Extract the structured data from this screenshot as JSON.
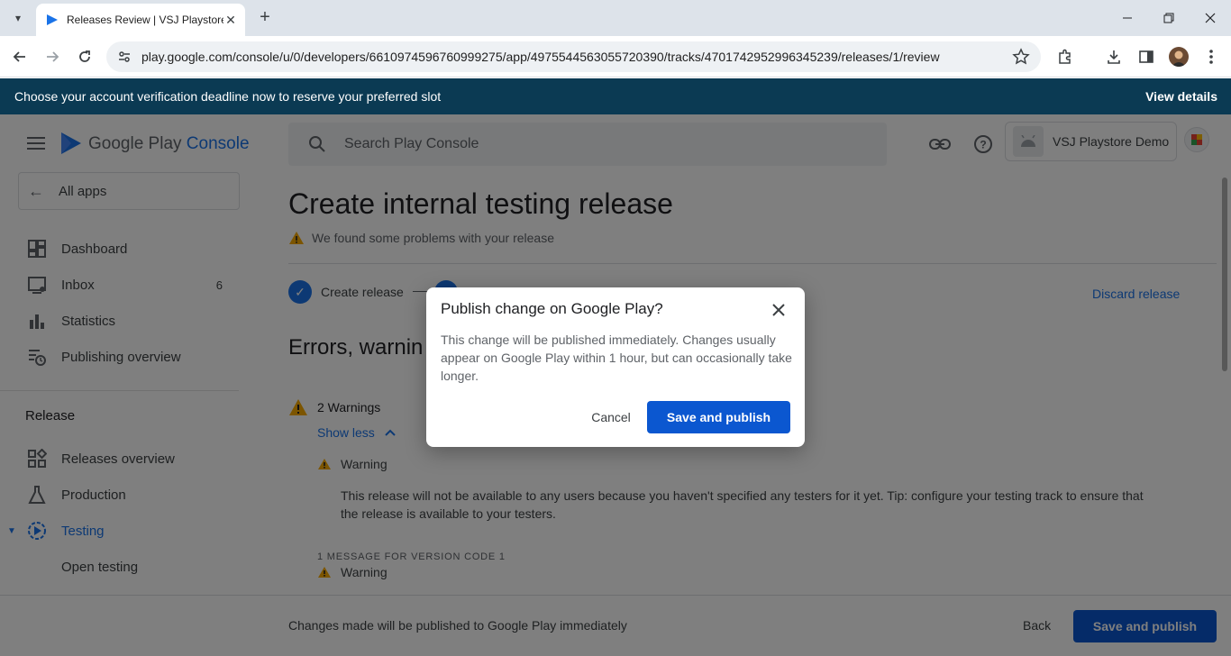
{
  "browser": {
    "tab_title": "Releases Review | VSJ Playstore",
    "url": "play.google.com/console/u/0/developers/6610974596760999275/app/4975544563055720390/tracks/4701742952996345239/releases/1/review"
  },
  "banner": {
    "message": "Choose your account verification deadline now to reserve your preferred slot",
    "link": "View details"
  },
  "header": {
    "logo_google_play": "Google Play",
    "logo_console": "Console",
    "search_placeholder": "Search Play Console",
    "account_name": "VSJ Playstore Demo"
  },
  "sidebar": {
    "all_apps": "All apps",
    "items": [
      {
        "label": "Dashboard"
      },
      {
        "label": "Inbox",
        "count": "6"
      },
      {
        "label": "Statistics"
      },
      {
        "label": "Publishing overview"
      }
    ],
    "release_section": "Release",
    "release_items": [
      {
        "label": "Releases overview"
      },
      {
        "label": "Production"
      },
      {
        "label": "Testing"
      },
      {
        "label": "Open testing"
      }
    ]
  },
  "main": {
    "title": "Create internal testing release",
    "problem_notice": "We found some problems with your release",
    "step1": "Create release",
    "discard": "Discard release",
    "section_title": "Errors, warnin",
    "warnings_count": "2 Warnings",
    "show_less": "Show less",
    "warning_label": "Warning",
    "warning_text": "This release will not be available to any users because you haven't specified any testers for it yet. Tip: configure your testing track to ensure that the release is available to your testers.",
    "version_message": "1 MESSAGE FOR VERSION CODE 1",
    "warning_label_2": "Warning"
  },
  "footer": {
    "text": "Changes made will be published to Google Play immediately",
    "back": "Back",
    "save_publish": "Save and publish"
  },
  "dialog": {
    "title": "Publish change on Google Play?",
    "body": "This change will be published immediately. Changes usually appear on Google Play within 1 hour, but can occasionally take longer.",
    "cancel": "Cancel",
    "confirm": "Save and publish"
  },
  "colors": {
    "primary": "#0b57d0",
    "link": "#1a73e8",
    "banner": "#0b3a53",
    "warning": "#f9ab00"
  }
}
